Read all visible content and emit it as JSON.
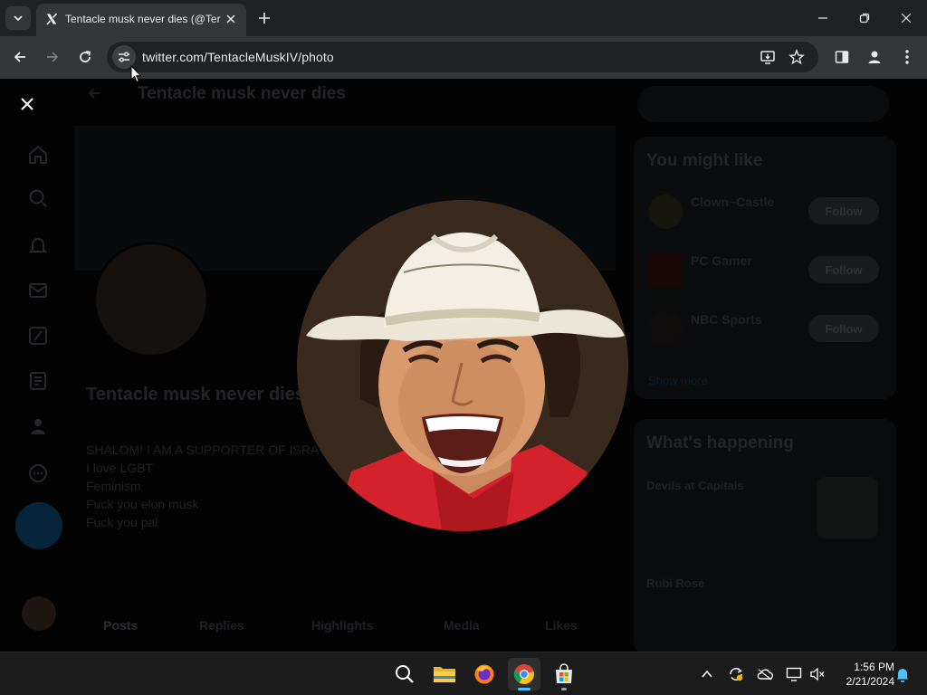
{
  "browser": {
    "tab_title": "Tentacle musk never dies (@Ter",
    "url": "twitter.com/TentacleMuskIV/photo"
  },
  "profile": {
    "header_name": "Tentacle musk never dies",
    "display_name": "Tentacle musk never dies",
    "bio_lines": [
      "SHALOM! I AM A SUPPORTER OF ISRA",
      "I love LGBT",
      "Feminism",
      "Fuck you elon musk",
      "Fuck you pal"
    ],
    "tabs": [
      "Posts",
      "Replies",
      "Highlights",
      "Media",
      "Likes"
    ]
  },
  "sidebar": {
    "might_like_title": "You might like",
    "suggestions": [
      {
        "name": "Clown~Castle",
        "follow": "Follow"
      },
      {
        "name": "PC Gamer",
        "follow": "Follow"
      },
      {
        "name": "NBC Sports",
        "follow": "Follow"
      }
    ],
    "show_more": "Show more",
    "happening_title": "What's happening",
    "trends": [
      "Devils at Capitals",
      "Rubi Rose"
    ]
  },
  "taskbar": {
    "time": "1:56 PM",
    "date": "2/21/2024"
  },
  "colors": {
    "accent_blue": "#1d9bf0",
    "chrome_dark": "#202124",
    "chrome_toolbar": "#35363a"
  }
}
